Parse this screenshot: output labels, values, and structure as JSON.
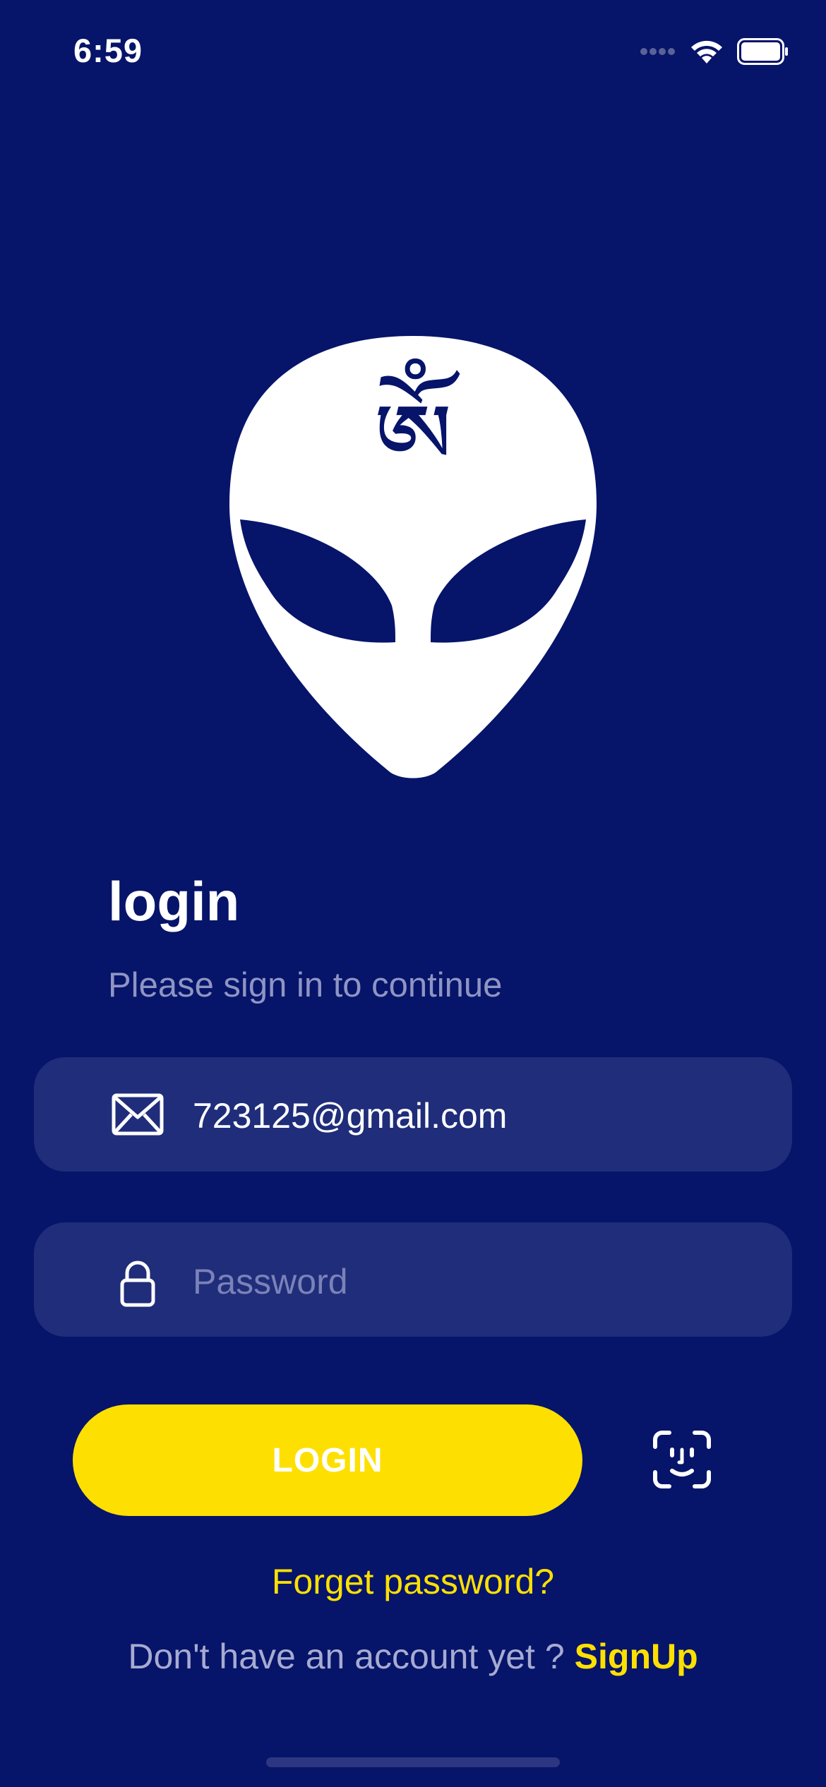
{
  "status_bar": {
    "time": "6:59"
  },
  "logo": {
    "glyph": "ཨོཾ"
  },
  "header": {
    "title": "login",
    "subtitle": "Please sign in to continue"
  },
  "form": {
    "email": {
      "value": "723125@gmail.com",
      "icon": "envelope-icon"
    },
    "password": {
      "placeholder": "Password",
      "value": "",
      "icon": "lock-icon"
    }
  },
  "actions": {
    "login_label": "LOGIN",
    "faceid_icon": "face-id-icon",
    "forget_label": "Forget password?",
    "signup_prompt": "Don't have an account yet ?",
    "signup_label": "SignUp"
  },
  "colors": {
    "background": "#06146a",
    "field": "#1f2d7a",
    "accent": "#fde001"
  }
}
